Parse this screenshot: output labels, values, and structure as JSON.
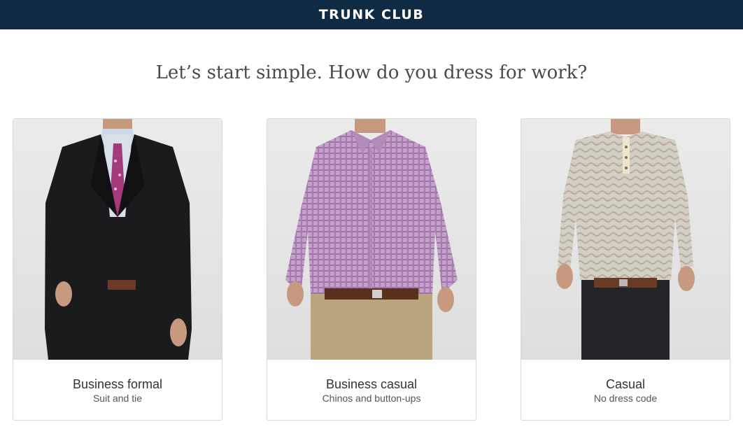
{
  "header": {
    "brand": "TRUNK CLUB"
  },
  "question": "Let’s start simple. How do you dress for work?",
  "options": [
    {
      "title": "Business formal",
      "subtitle": "Suit and tie",
      "image": "man-in-black-suit-and-tie"
    },
    {
      "title": "Business casual",
      "subtitle": "Chinos and button-ups",
      "image": "man-in-plaid-shirt-and-chinos"
    },
    {
      "title": "Casual",
      "subtitle": "No dress code",
      "image": "man-in-henley-and-dark-jeans"
    }
  ],
  "colors": {
    "header_bg": "#0f2a43",
    "suit": "#1b1b1e",
    "tie": "#a43a7a",
    "plaid_shirt": "#b48ab8",
    "chinos": "#bba57e",
    "henley": "#cfcac0",
    "jeans": "#222428"
  }
}
